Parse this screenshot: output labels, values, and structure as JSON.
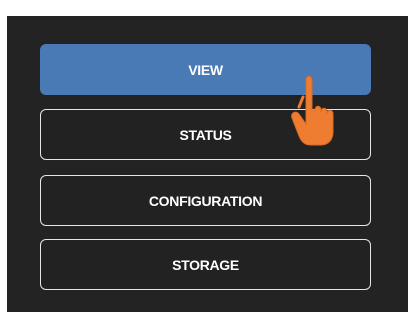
{
  "menu": {
    "items": [
      {
        "label": "VIEW",
        "state": "active"
      },
      {
        "label": "STATUS",
        "state": "normal"
      },
      {
        "label": "CONFIGURATION",
        "state": "normal"
      },
      {
        "label": "STORAGE",
        "state": "normal"
      }
    ]
  },
  "colors": {
    "panel_background": "#232323",
    "active_button": "#4a7ab5",
    "button_border": "#e6e6e6",
    "pointer_fill": "#ee7d31"
  },
  "icons": {
    "pointer": "hand-pointer-icon"
  }
}
